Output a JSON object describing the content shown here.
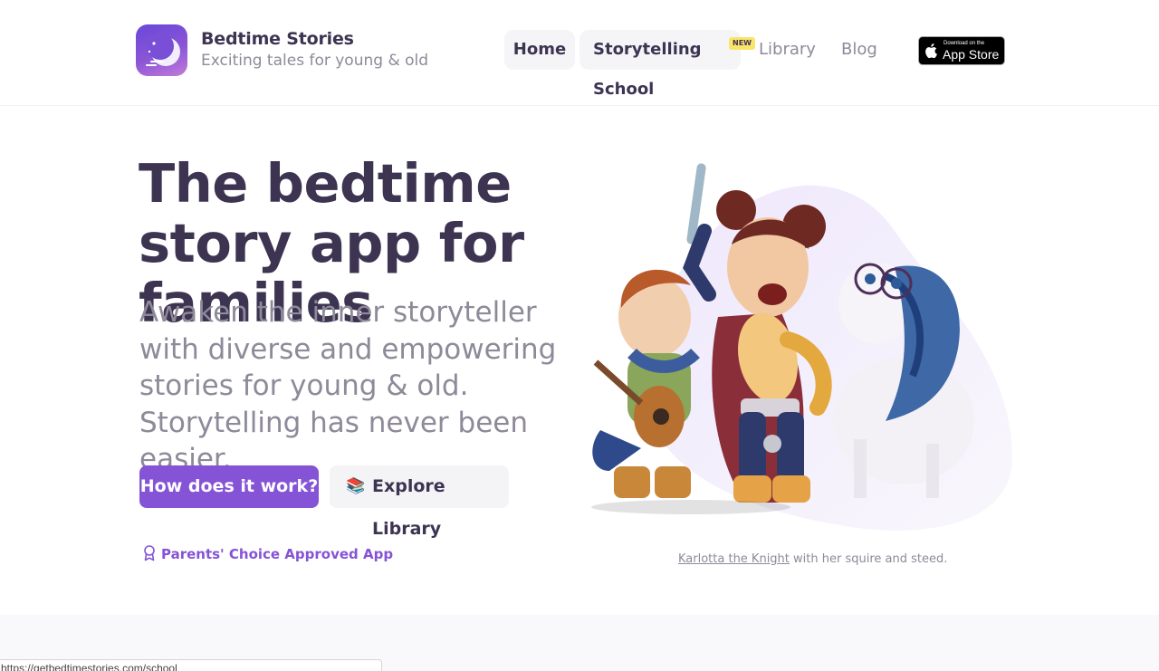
{
  "header": {
    "brand_name": "Bedtime Stories",
    "brand_tagline": "Exciting tales for young & old",
    "nav": {
      "home": "Home",
      "school": "Storytelling School",
      "school_badge": "NEW",
      "library": "Library",
      "blog": "Blog"
    },
    "appstore": {
      "small": "Download on the",
      "big": "App Store"
    }
  },
  "hero": {
    "title": "The bedtime story app for families",
    "subtitle": "Awaken the inner storyteller with diverse and empowering stories for young & old. Storytelling has never been easier.",
    "primary_button": "How does it work?",
    "secondary_button": "Explore Library",
    "secondary_icon": "books-icon",
    "award": "Parents' Choice Approved App",
    "award_icon": "ribbon-icon"
  },
  "illustration": {
    "caption_link": "Karlotta the Knight",
    "caption_rest": " with her squire and steed."
  },
  "status_bar": {
    "url": "https://getbedtimestories.com/school"
  },
  "colors": {
    "accent": "#8553d6",
    "text_dark": "#3d3452",
    "text_muted": "#8e8a99",
    "badge": "#fbe46a"
  }
}
